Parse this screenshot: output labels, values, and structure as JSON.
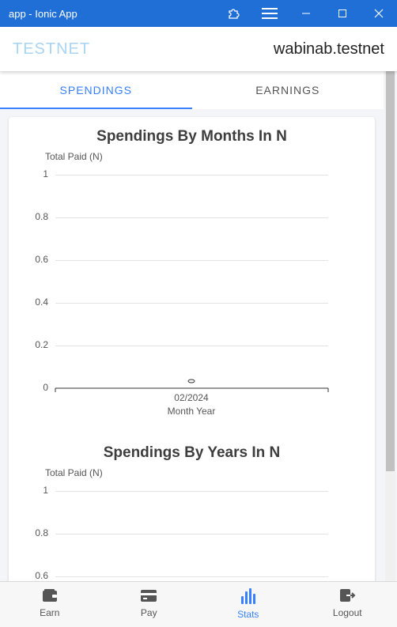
{
  "window": {
    "title": "app - Ionic App"
  },
  "header": {
    "brand": "TESTNET",
    "account": "wabinab.testnet"
  },
  "segments": [
    {
      "label": "SPENDINGS",
      "active": true
    },
    {
      "label": "EARNINGS",
      "active": false
    }
  ],
  "charts": {
    "months": {
      "title": "Spendings By Months In N",
      "ylabel": "Total Paid (N)",
      "yticks": [
        "1",
        "0.8",
        "0.6",
        "0.4",
        "0.2",
        "0"
      ],
      "xlabel": "Month Year",
      "xtick": "02/2024"
    },
    "years": {
      "title": "Spendings By Years In N",
      "ylabel": "Total Paid (N)",
      "yticks": [
        "1",
        "0.8",
        "0.6"
      ]
    }
  },
  "chart_data": [
    {
      "type": "scatter",
      "title": "Spendings By Months In N",
      "xlabel": "Month Year",
      "ylabel": "Total Paid (N)",
      "categories": [
        "02/2024"
      ],
      "values": [
        0
      ],
      "ylim": [
        0,
        1
      ],
      "grid": true
    },
    {
      "type": "scatter",
      "title": "Spendings By Years In N",
      "xlabel": "",
      "ylabel": "Total Paid (N)",
      "categories": [],
      "values": [],
      "ylim": [
        0,
        1
      ],
      "grid": true
    }
  ],
  "tabs": [
    {
      "label": "Earn",
      "icon": "wallet-icon",
      "active": false
    },
    {
      "label": "Pay",
      "icon": "card-icon",
      "active": false
    },
    {
      "label": "Stats",
      "icon": "stats-chart-icon",
      "active": true
    },
    {
      "label": "Logout",
      "icon": "logout-icon",
      "active": false
    }
  ],
  "colors": {
    "titlebar": "#1f6fd6",
    "accent": "#3880ff",
    "brand": "#a9d4f2"
  }
}
